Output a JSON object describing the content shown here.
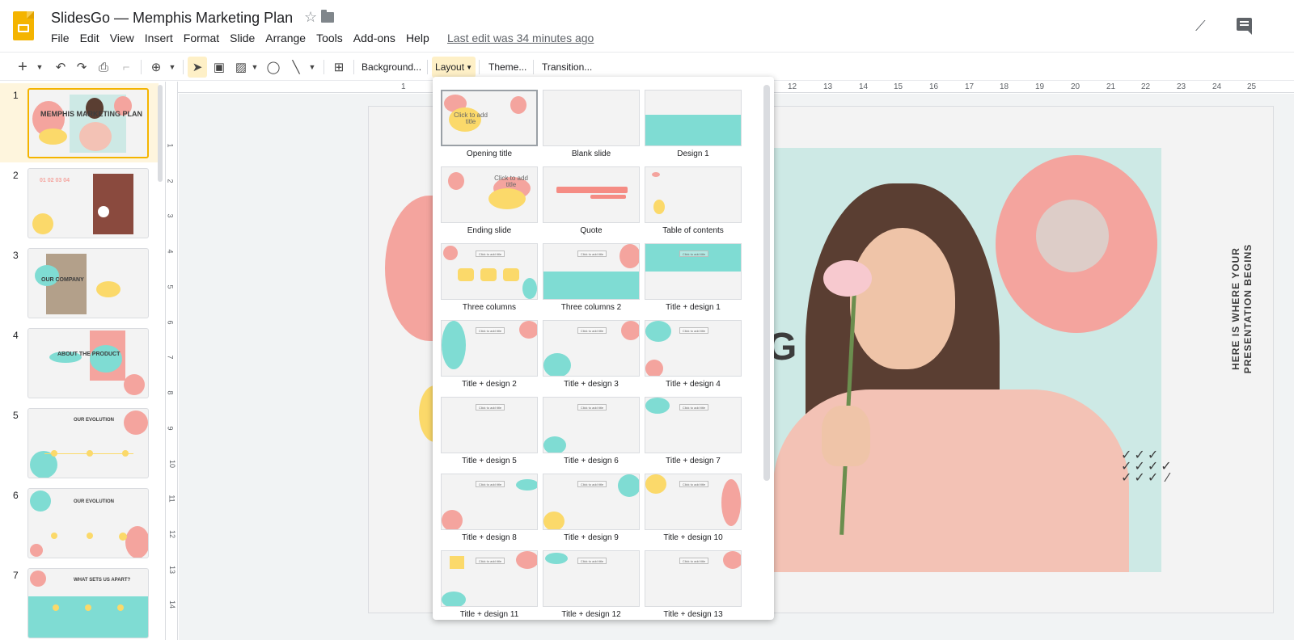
{
  "app": {
    "title": "SlidesGo — Memphis Marketing Plan",
    "last_edit": "Last edit was 34 minutes ago",
    "menu": [
      "File",
      "Edit",
      "View",
      "Insert",
      "Format",
      "Slide",
      "Arrange",
      "Tools",
      "Add-ons",
      "Help"
    ]
  },
  "toolbar": {
    "background": "Background...",
    "layout": "Layout",
    "theme": "Theme...",
    "transition": "Transition..."
  },
  "filmstrip": {
    "slides": [
      {
        "number": "1",
        "text": "MEMPHIS MARKETING PLAN"
      },
      {
        "number": "2",
        "text": "01 02 03 04"
      },
      {
        "number": "3",
        "text": "OUR COMPANY"
      },
      {
        "number": "4",
        "text": "ABOUT THE PRODUCT"
      },
      {
        "number": "5",
        "text": "OUR EVOLUTION"
      },
      {
        "number": "6",
        "text": "OUR EVOLUTION"
      },
      {
        "number": "7",
        "text": "WHAT SETS US APART?"
      }
    ]
  },
  "ruler": {
    "h": [
      "1",
      "12",
      "13",
      "14",
      "15",
      "16",
      "17",
      "18",
      "19",
      "20",
      "21",
      "22",
      "23",
      "24",
      "25"
    ],
    "v": [
      "1",
      "2",
      "3",
      "4",
      "5",
      "6",
      "7",
      "8",
      "9",
      "10",
      "11",
      "12",
      "13",
      "14"
    ]
  },
  "slide": {
    "g_letter": "G",
    "vertical_text": "HERE IS WHERE YOUR PRESENTATION BEGINS"
  },
  "layouts": [
    {
      "label": "Opening title",
      "placeholder": "Click to add title"
    },
    {
      "label": "Blank slide"
    },
    {
      "label": "Design 1"
    },
    {
      "label": "Ending slide",
      "placeholder": "Click to add title"
    },
    {
      "label": "Quote"
    },
    {
      "label": "Table of contents"
    },
    {
      "label": "Three columns",
      "placeholder": "Click to add title"
    },
    {
      "label": "Three columns 2",
      "placeholder": "Click to add title"
    },
    {
      "label": "Title + design 1",
      "placeholder": "Click to add title"
    },
    {
      "label": "Title + design 2",
      "placeholder": "Click to add title"
    },
    {
      "label": "Title + design 3",
      "placeholder": "Click to add title"
    },
    {
      "label": "Title + design 4",
      "placeholder": "Click to add title"
    },
    {
      "label": "Title + design 5",
      "placeholder": "Click to add title"
    },
    {
      "label": "Title + design 6",
      "placeholder": "Click to add title"
    },
    {
      "label": "Title + design 7",
      "placeholder": "Click to add title"
    },
    {
      "label": "Title + design 8",
      "placeholder": "Click to add title"
    },
    {
      "label": "Title + design 9",
      "placeholder": "Click to add title"
    },
    {
      "label": "Title + design 10",
      "placeholder": "Click to add title"
    },
    {
      "label": "Title + design 11",
      "placeholder": "Click to add title"
    },
    {
      "label": "Title + design 12",
      "placeholder": "Click to add title"
    },
    {
      "label": "Title + design 13",
      "placeholder": "Click to add title"
    }
  ],
  "colors": {
    "accent": "#f4b400",
    "pink": "#f4a49e",
    "teal": "#7fdcd3",
    "yellow": "#fbd96a"
  }
}
